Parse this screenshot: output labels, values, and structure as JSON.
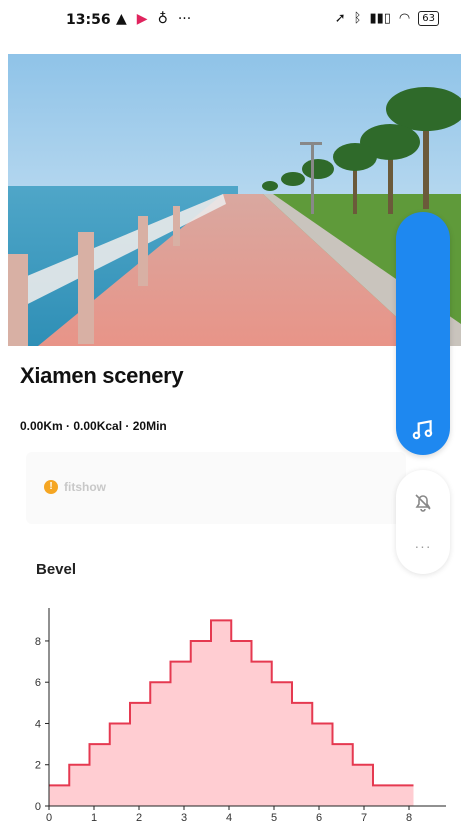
{
  "status_bar": {
    "time": "13:56",
    "left_icons": [
      "warning-icon",
      "flag-icon",
      "location-pin-icon",
      "more-icon"
    ],
    "right_icons": [
      "navigation-icon",
      "bluetooth-icon",
      "signal-icon",
      "wifi-icon"
    ],
    "battery": "63"
  },
  "route": {
    "title": "Xiamen scenery",
    "stats": "0.00Km · 0.00Kcal · 20Min"
  },
  "brand": {
    "name": "fitshow"
  },
  "section": {
    "bevel_label": "Bevel"
  },
  "controls": {
    "more_label": "···"
  },
  "colors": {
    "accent": "#1e88f0",
    "chart_fill": "#ffcdd2",
    "chart_line": "#e53950",
    "brand_dot": "#f5a623"
  },
  "chart_data": {
    "type": "area",
    "step": true,
    "xlabel": "",
    "ylabel": "",
    "x_ticks": [
      0,
      1,
      2,
      3,
      4,
      5,
      6,
      7,
      8
    ],
    "y_ticks": [
      0,
      2,
      4,
      6,
      8
    ],
    "xlim": [
      0,
      8.6
    ],
    "ylim": [
      0,
      9.5
    ],
    "x_step": 0.45,
    "values": [
      1,
      2,
      3,
      4,
      5,
      6,
      7,
      8,
      9,
      8,
      7,
      6,
      5,
      4,
      3,
      2,
      1,
      1
    ],
    "grid": false
  }
}
